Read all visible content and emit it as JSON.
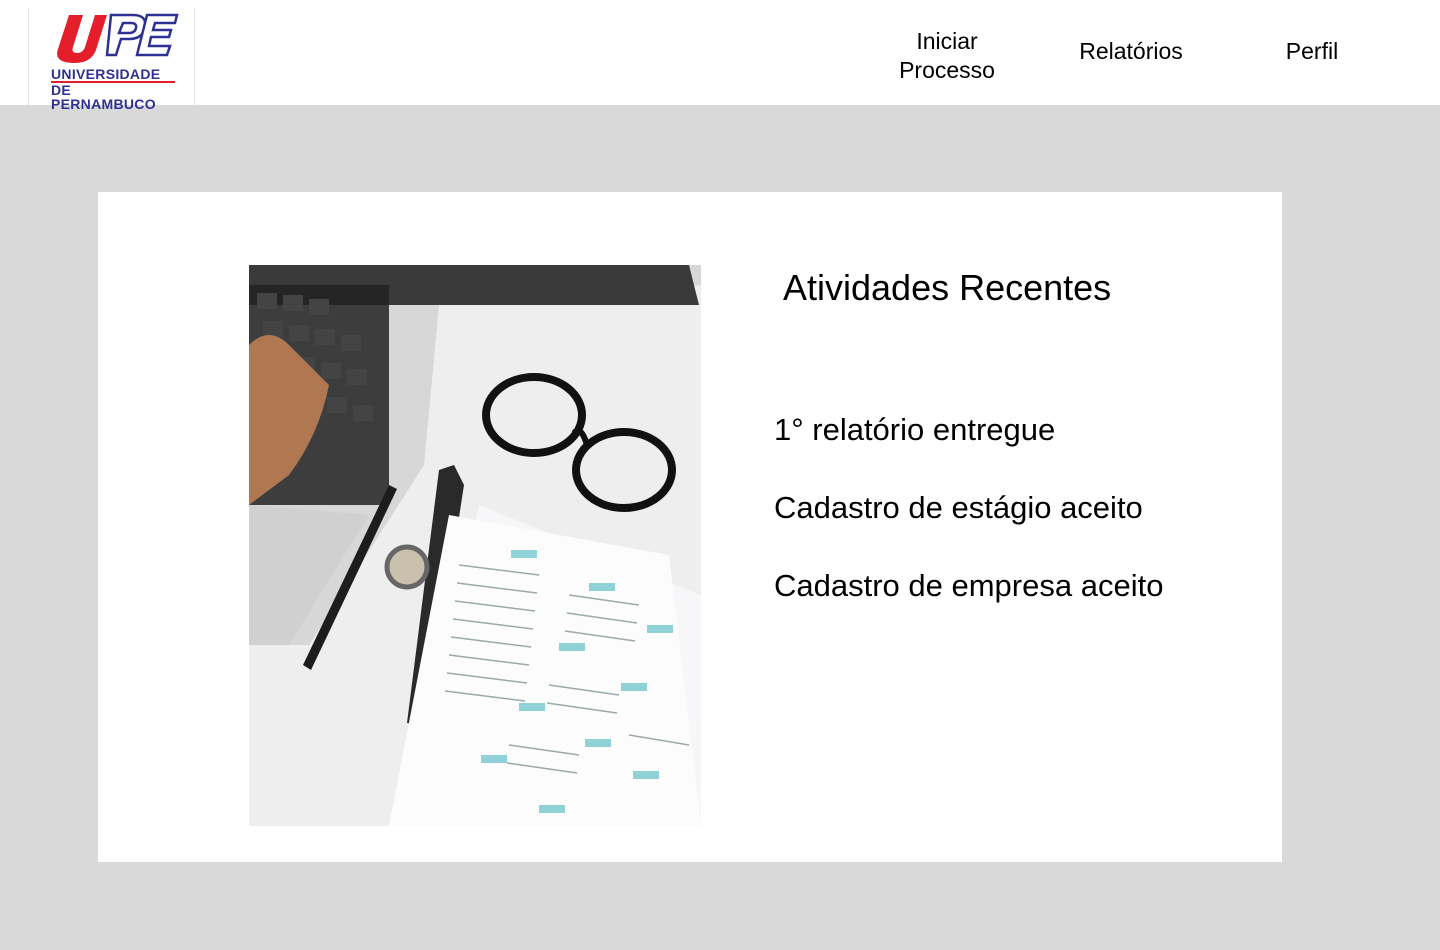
{
  "logo": {
    "line1": "UNIVERSIDADE",
    "line2": "DE PERNAMBUCO",
    "colors": {
      "red": "#e41e2b",
      "blue": "#2e3192"
    }
  },
  "nav": {
    "iniciar_processo": "Iniciar Processo",
    "relatorios": "Relatórios",
    "perfil": "Perfil"
  },
  "main": {
    "title": "Atividades Recentes",
    "activities": [
      "1° relatório entregue",
      "Cadastro de estágio aceito",
      "Cadastro de empresa aceito"
    ]
  },
  "colors": {
    "background": "#d9d9d9",
    "header": "#ffffff",
    "card": "#ffffff"
  }
}
